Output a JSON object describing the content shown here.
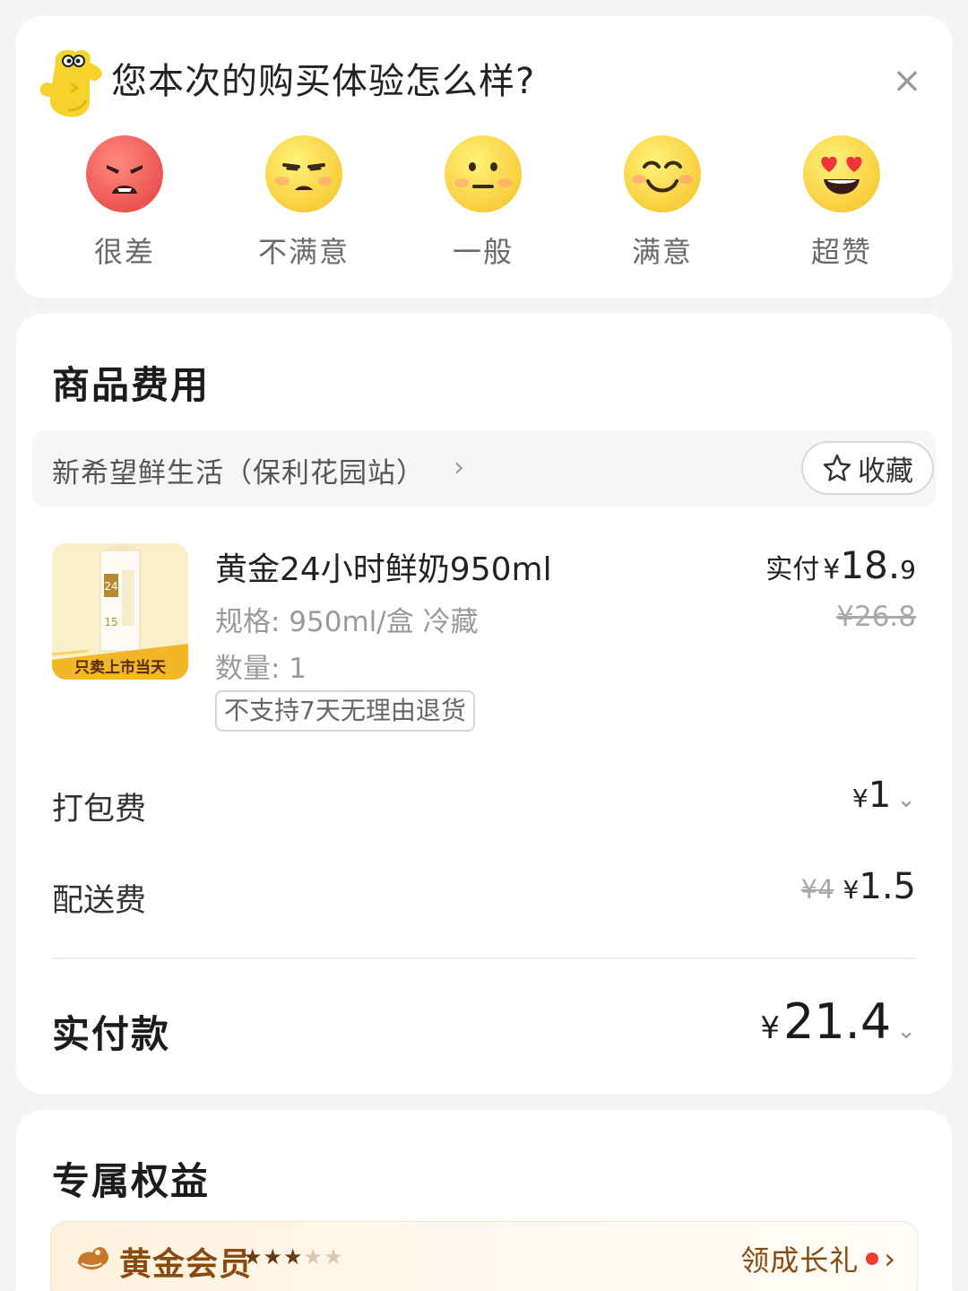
{
  "feedback": {
    "title": "您本次的购买体验怎么样?",
    "close_icon": "close-icon",
    "options": [
      {
        "label": "很差",
        "icon": "angry-face-icon"
      },
      {
        "label": "不满意",
        "icon": "unamused-face-icon"
      },
      {
        "label": "一般",
        "icon": "neutral-face-icon"
      },
      {
        "label": "满意",
        "icon": "smiling-face-icon"
      },
      {
        "label": "超赞",
        "icon": "heart-eyes-face-icon"
      }
    ]
  },
  "fees": {
    "title": "商品费用",
    "store": {
      "name": "新希望鲜生活（保利花园站）",
      "chevron": "›"
    },
    "favorite_label": "收藏",
    "product": {
      "name": "黄金24小时鲜奶950ml",
      "spec": "规格: 950ml/盒 冷藏",
      "quantity": "数量: 1",
      "tag": "不支持7天无理由退货",
      "image_banner": "只卖上市当天",
      "image_badge": "24",
      "image_number": "15",
      "paid_label": "实付",
      "currency": "¥",
      "paid_int": "18.",
      "paid_dec": "9",
      "original_price": "¥26.8"
    },
    "packing": {
      "label": "打包费",
      "currency": "¥",
      "amount": "1",
      "chevron": "⌄"
    },
    "delivery": {
      "label": "配送费",
      "original": "¥4",
      "currency": "¥",
      "amount": "1.5"
    },
    "total": {
      "label": "实付款",
      "currency": "¥",
      "amount": "21.4",
      "chevron": "⌄"
    }
  },
  "benefits": {
    "title": "专属权益",
    "member_title": "黄金会员",
    "stars_filled": 3,
    "stars_total": 5,
    "gift_label": "领成长礼",
    "gift_chevron": "›"
  },
  "colors": {
    "page_bg": "#f4f4f4",
    "card_bg": "#ffffff",
    "member_brown": "#8a4b10",
    "notice_red": "#f03c2e"
  }
}
